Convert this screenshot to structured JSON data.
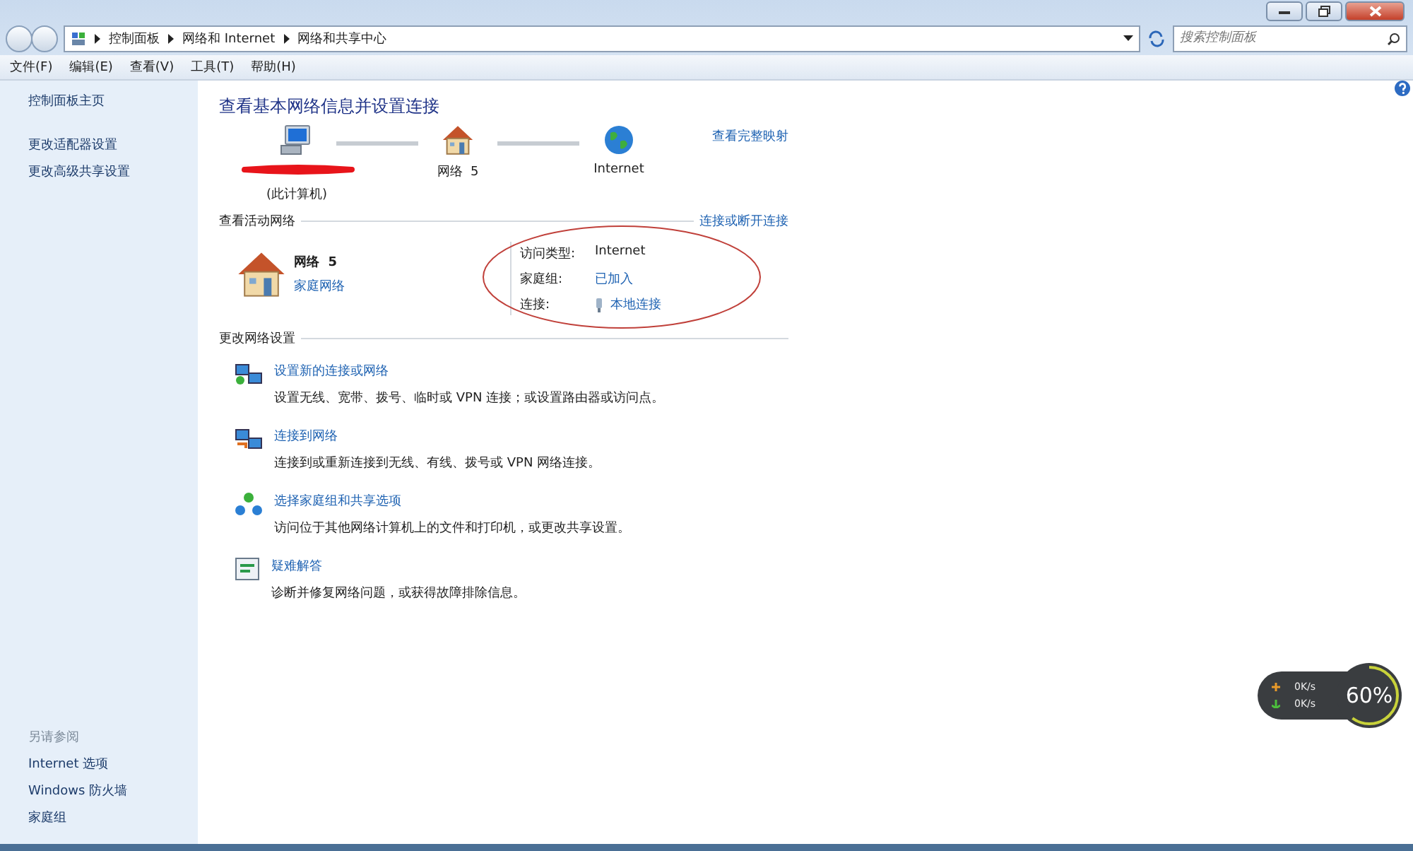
{
  "address_bar": {
    "breadcrumbs": [
      "控制面板",
      "网络和 Internet",
      "网络和共享中心"
    ],
    "search_placeholder": "搜索控制面板"
  },
  "menu": [
    "文件(F)",
    "编辑(E)",
    "查看(V)",
    "工具(T)",
    "帮助(H)"
  ],
  "sidebar": {
    "links": [
      "控制面板主页",
      "更改适配器设置",
      "更改高级共享设置"
    ],
    "see_also_heading": "另请参阅",
    "see_also": [
      "Internet 选项",
      "Windows 防火墙",
      "家庭组"
    ]
  },
  "main": {
    "title": "查看基本网络信息并设置连接",
    "map_link": "查看完整映射",
    "map_nodes": [
      {
        "kind": "computer",
        "label": "(此计算机)"
      },
      {
        "kind": "house",
        "label": "网络  5"
      },
      {
        "kind": "globe",
        "label": "Internet"
      }
    ],
    "active_heading": "查看活动网络",
    "active_link": "连接或断开连接",
    "network": {
      "name": "网络  5",
      "type": "家庭网络"
    },
    "properties": [
      {
        "kind": "text",
        "label": "访问类型:",
        "value": "Internet"
      },
      {
        "kind": "link",
        "label": "家庭组:",
        "value": "已加入"
      },
      {
        "kind": "adapter",
        "label": "连接:",
        "value": "本地连接"
      }
    ],
    "change_heading": "更改网络设置",
    "tasks": [
      {
        "kind": "new",
        "title": "设置新的连接或网络",
        "description": "设置无线、宽带、拨号、临时或 VPN 连接；或设置路由器或访问点。"
      },
      {
        "kind": "connect",
        "title": "连接到网络",
        "description": "连接到或重新连接到无线、有线、拨号或 VPN 网络连接。"
      },
      {
        "kind": "homegroup",
        "title": "选择家庭组和共享选项",
        "description": "访问位于其他网络计算机上的文件和打印机，或更改共享设置。"
      },
      {
        "kind": "troubleshoot",
        "title": "疑难解答",
        "description": "诊断并修复网络问题，或获得故障排除信息。"
      }
    ]
  },
  "speed_widget": {
    "upload": "0K/s",
    "download": "0K/s",
    "reading": "60%",
    "level": 0.6
  }
}
